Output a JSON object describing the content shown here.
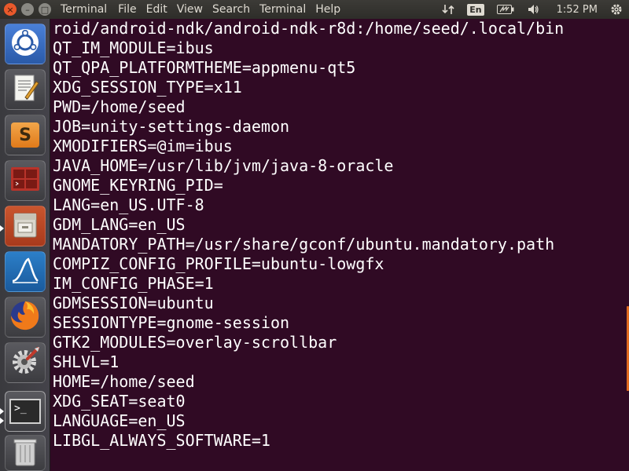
{
  "topbar": {
    "app_name": "Terminal",
    "menus": [
      "File",
      "Edit",
      "View",
      "Search",
      "Terminal",
      "Help"
    ],
    "lang": "En",
    "clock": "1:52 PM",
    "window_buttons": {
      "close": "×",
      "minimize": "–",
      "maximize": "□"
    }
  },
  "launcher": {
    "items": [
      {
        "name": "ubuntu-dash",
        "icon": "ubuntu-logo-icon"
      },
      {
        "name": "text-editor",
        "icon": "text-editor-icon"
      },
      {
        "name": "sublime-text",
        "icon": "sublime-text-icon"
      },
      {
        "name": "terminal-red",
        "icon": "terminal-red-icon"
      },
      {
        "name": "file-manager",
        "icon": "file-manager-icon"
      },
      {
        "name": "wireshark",
        "icon": "wireshark-icon"
      },
      {
        "name": "firefox",
        "icon": "firefox-icon"
      },
      {
        "name": "system-settings",
        "icon": "settings-icon"
      },
      {
        "name": "terminal",
        "icon": "terminal-icon"
      },
      {
        "name": "trash",
        "icon": "trash-icon"
      }
    ],
    "sublime_glyph": "S",
    "terminal_prompt": ">_"
  },
  "terminal": {
    "lines": [
      "roid/android-ndk/android-ndk-r8d:/home/seed/.local/bin",
      "QT_IM_MODULE=ibus",
      "QT_QPA_PLATFORMTHEME=appmenu-qt5",
      "XDG_SESSION_TYPE=x11",
      "PWD=/home/seed",
      "JOB=unity-settings-daemon",
      "XMODIFIERS=@im=ibus",
      "JAVA_HOME=/usr/lib/jvm/java-8-oracle",
      "GNOME_KEYRING_PID=",
      "LANG=en_US.UTF-8",
      "GDM_LANG=en_US",
      "MANDATORY_PATH=/usr/share/gconf/ubuntu.mandatory.path",
      "COMPIZ_CONFIG_PROFILE=ubuntu-lowgfx",
      "IM_CONFIG_PHASE=1",
      "GDMSESSION=ubuntu",
      "SESSIONTYPE=gnome-session",
      "GTK2_MODULES=overlay-scrollbar",
      "SHLVL=1",
      "HOME=/home/seed",
      "XDG_SEAT=seat0",
      "LANGUAGE=en_US",
      "LIBGL_ALWAYS_SOFTWARE=1"
    ]
  },
  "colors": {
    "terminal_bg": "#300a24",
    "terminal_fg": "#ffffff",
    "scrollbar": "#e06b1f",
    "panel": "#3c3b37"
  }
}
